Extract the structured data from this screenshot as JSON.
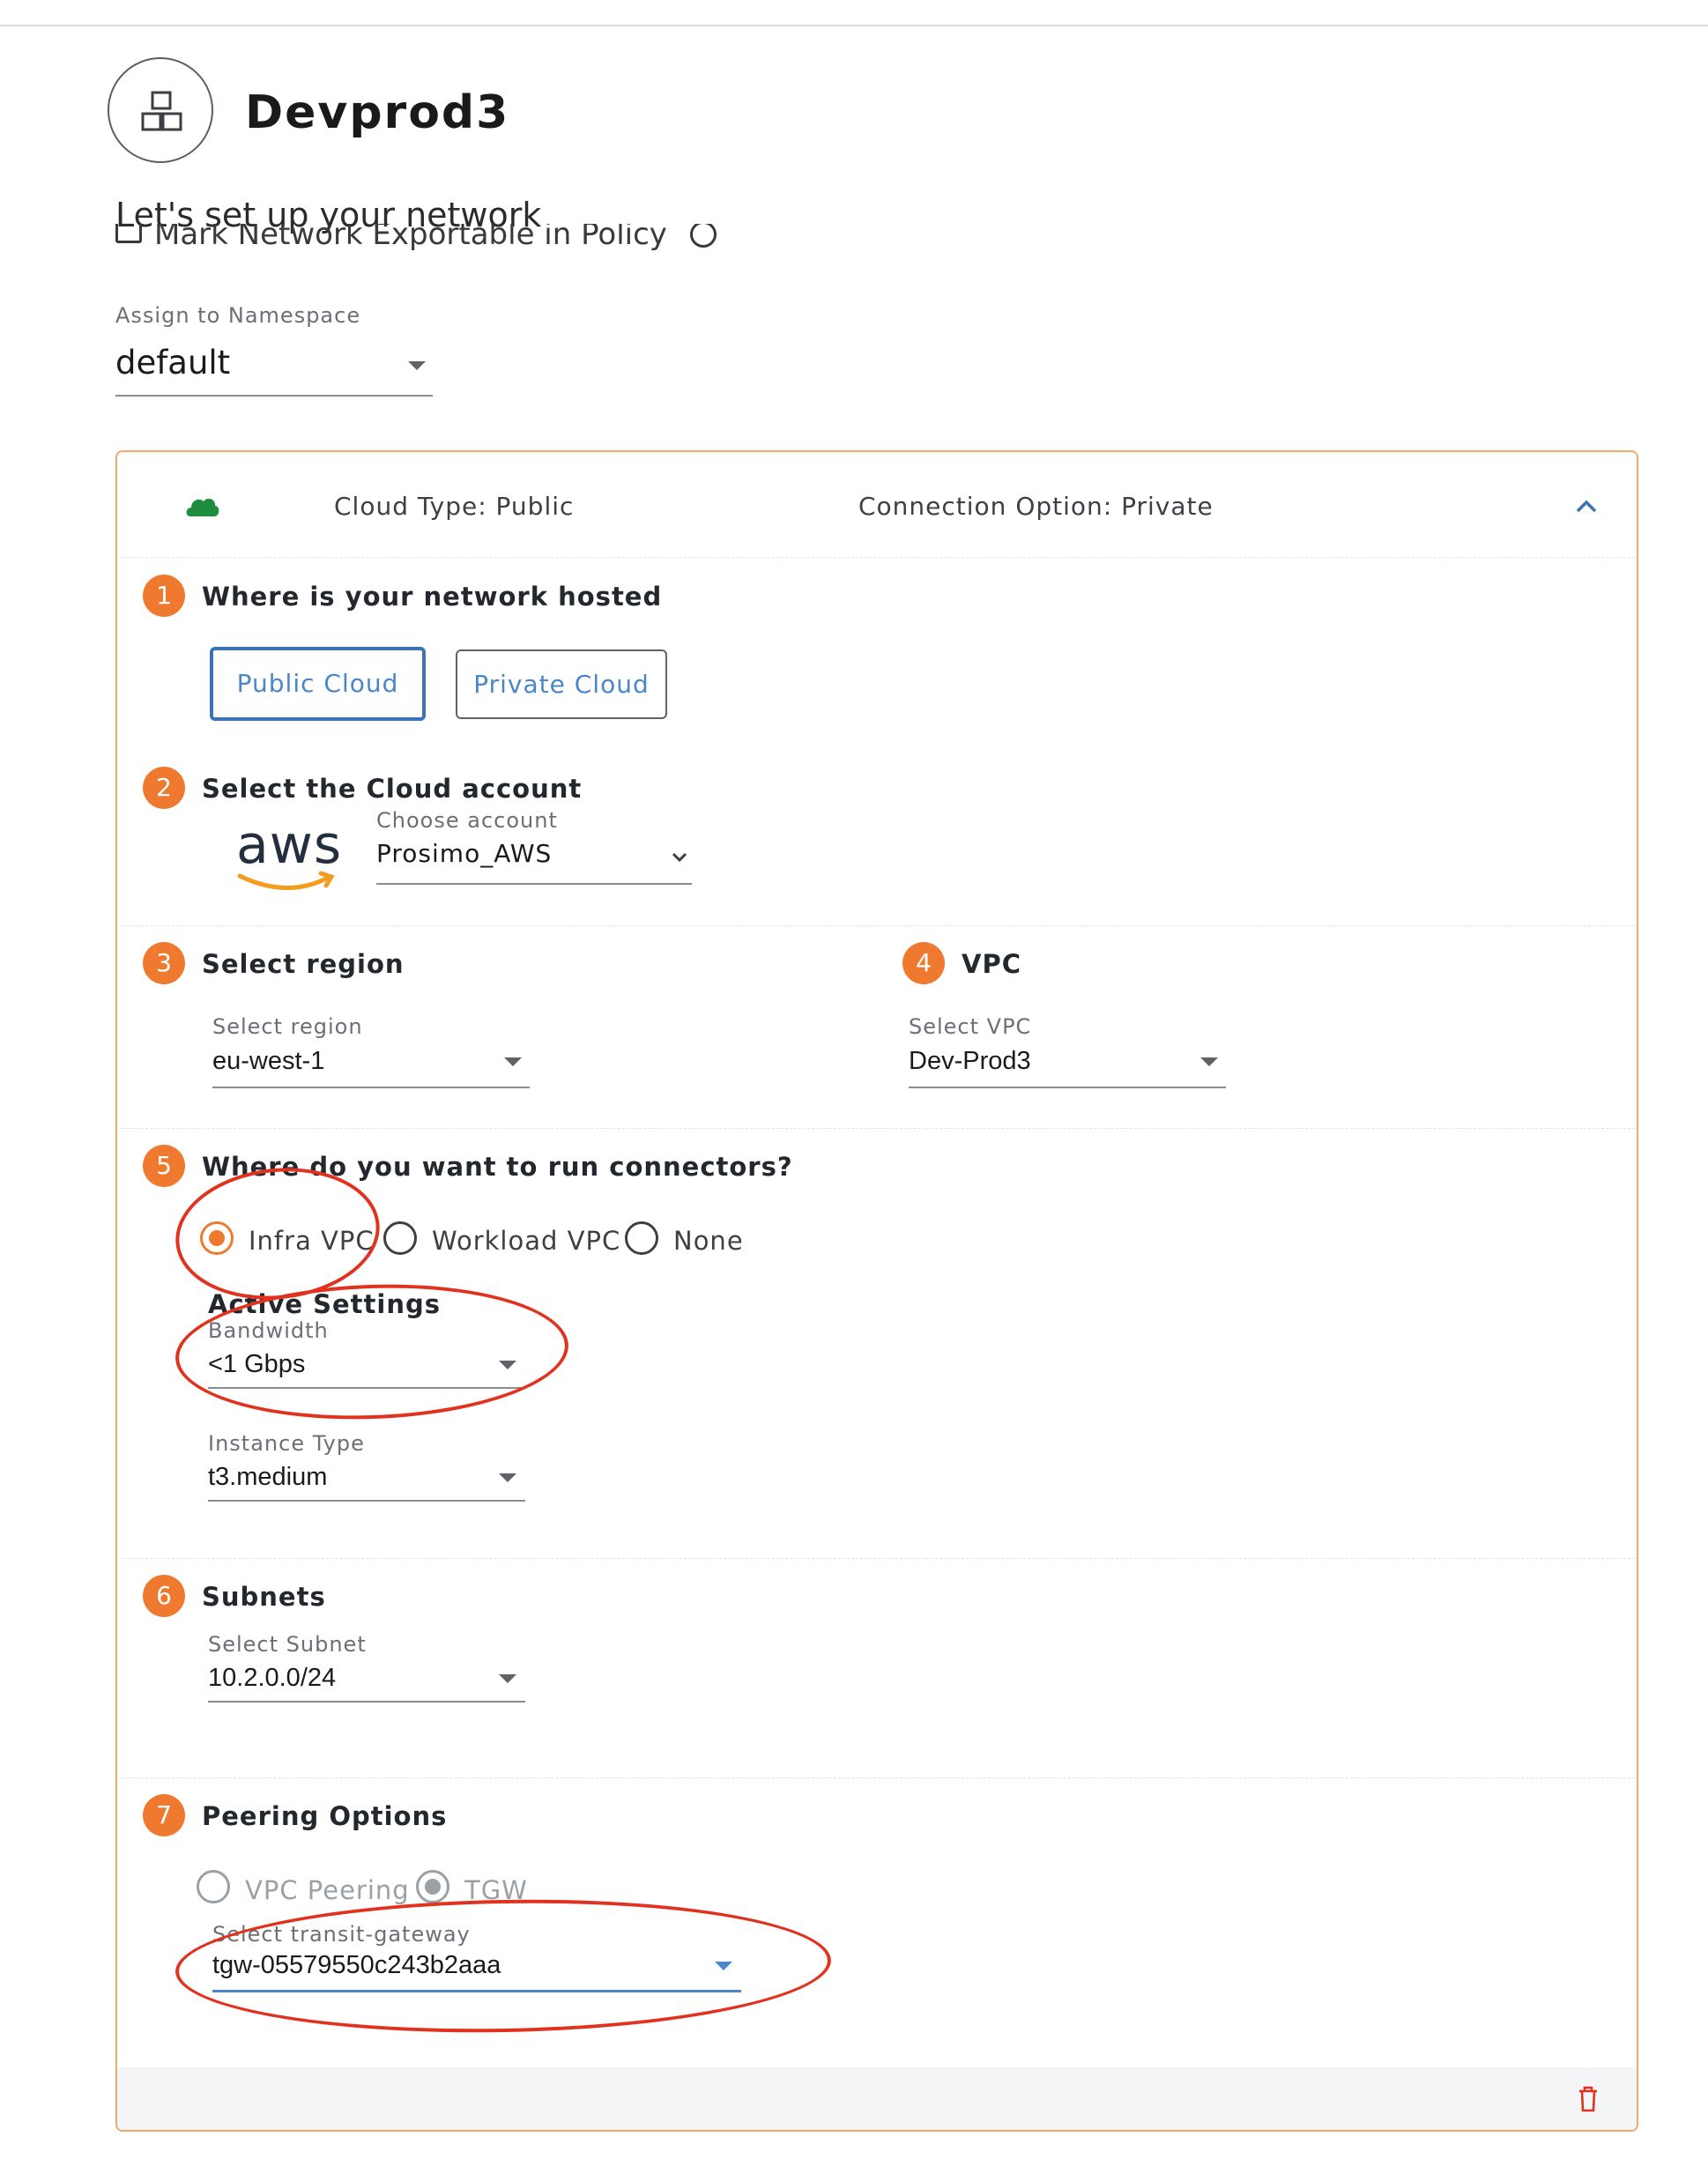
{
  "header": {
    "title": "Devprod3",
    "logo_icon": "network-blocks-icon"
  },
  "setup": {
    "subtitle": "Let's set up your network",
    "exportable_label": "Mark Network Exportable in Policy",
    "exportable_checked": false
  },
  "namespace": {
    "label": "Assign to Namespace",
    "value": "default"
  },
  "panel": {
    "cloud_type": "Cloud Type: Public",
    "connection_option": "Connection Option: Private",
    "cloud_icon_color": "#1e8e3e",
    "accent_color": "#ef7a2f"
  },
  "steps": {
    "s1": {
      "num": "1",
      "title": "Where is your network hosted",
      "public_label": "Public Cloud",
      "private_label": "Private Cloud",
      "selected": "Public Cloud"
    },
    "s2": {
      "num": "2",
      "title": "Select the Cloud account",
      "logo_text": "aws",
      "field_label": "Choose account",
      "value": "Prosimo_AWS"
    },
    "s3": {
      "num": "3",
      "title": "Select region",
      "field_label": "Select region",
      "value": "eu-west-1"
    },
    "s4": {
      "num": "4",
      "title": "VPC",
      "field_label": "Select VPC",
      "value": "Dev-Prod3"
    },
    "s5": {
      "num": "5",
      "title": "Where do you want to run connectors?",
      "options": [
        "Infra VPC",
        "Workload VPC",
        "None"
      ],
      "selected": "Infra VPC",
      "settings_title": "Active Settings",
      "bandwidth_label": "Bandwidth",
      "bandwidth_value": "<1 Gbps",
      "instance_label": "Instance Type",
      "instance_value": "t3.medium"
    },
    "s6": {
      "num": "6",
      "title": "Subnets",
      "field_label": "Select Subnet",
      "value": "10.2.0.0/24"
    },
    "s7": {
      "num": "7",
      "title": "Peering Options",
      "options": [
        "VPC Peering",
        "TGW"
      ],
      "selected": "TGW",
      "tgw_label": "Select transit-gateway",
      "tgw_value": "tgw-05579550c243b2aaa"
    }
  },
  "annotation_color": "#e0321e"
}
